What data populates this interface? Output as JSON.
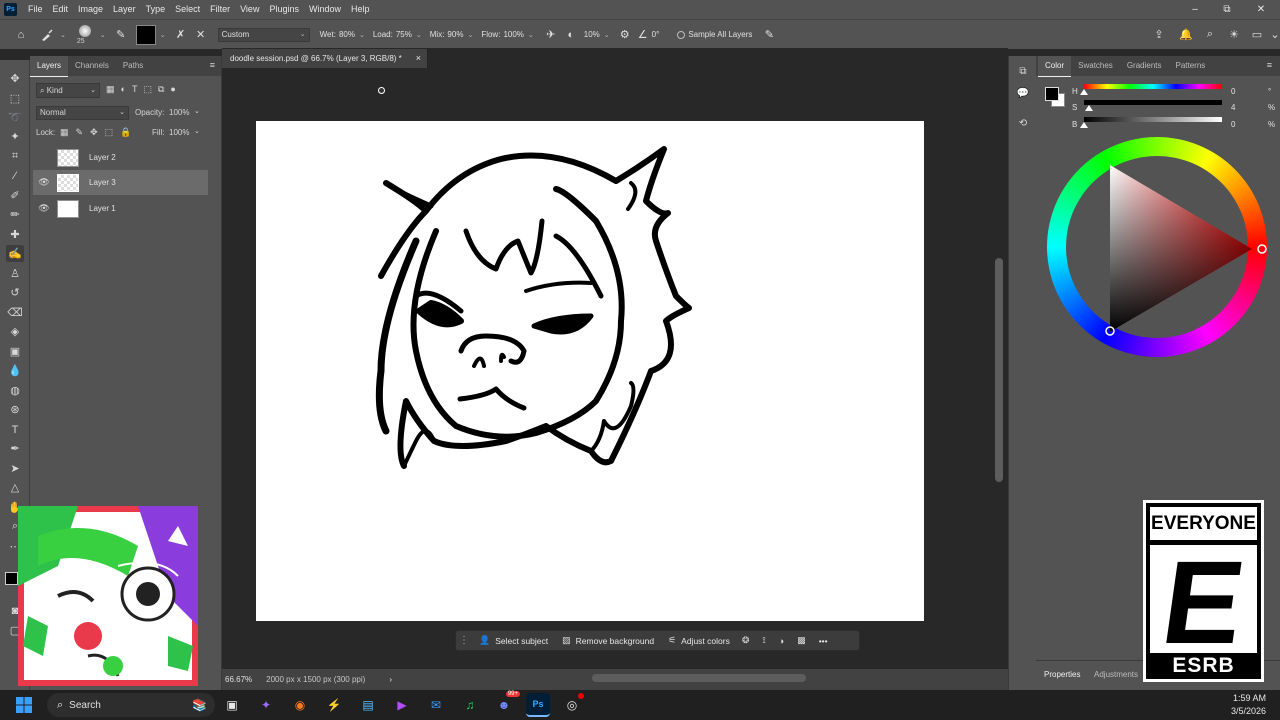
{
  "app": {
    "logo": "Ps"
  },
  "menubar": {
    "items": [
      "File",
      "Edit",
      "Image",
      "Layer",
      "Type",
      "Select",
      "Filter",
      "View",
      "Plugins",
      "Window",
      "Help"
    ]
  },
  "window_controls": {
    "minimize": "–",
    "restore": "⧉",
    "close": "✕"
  },
  "options": {
    "brush_size": "25",
    "preset": "Custom",
    "wet_label": "Wet:",
    "wet_value": "80%",
    "load_label": "Load:",
    "load_value": "75%",
    "mix_label": "Mix:",
    "mix_value": "90%",
    "flow_label": "Flow:",
    "flow_value": "100%",
    "smoothing_value": "10%",
    "angle_value": "0°",
    "sample_all_layers": "Sample All Layers"
  },
  "layers_panel": {
    "tabs": [
      "Layers",
      "Channels",
      "Paths"
    ],
    "filter_label": "Kind",
    "blend_mode": "Normal",
    "opacity_label": "Opacity:",
    "opacity_value": "100%",
    "lock_label": "Lock:",
    "fill_label": "Fill:",
    "fill_value": "100%",
    "layers": [
      {
        "name": "Layer 2",
        "visible": false,
        "selected": false
      },
      {
        "name": "Layer 3",
        "visible": true,
        "selected": true
      },
      {
        "name": "Layer 1",
        "visible": true,
        "selected": false
      }
    ]
  },
  "document": {
    "tab_title": "doodle session.psd @ 66.7% (Layer 3, RGB/8) *",
    "tab_close": "×",
    "zoom": "66.67%",
    "dimensions": "2000 px x 1500 px (300 ppi)",
    "status_caret": "›"
  },
  "context_bar": {
    "select_subject": "Select subject",
    "remove_background": "Remove background",
    "adjust_colors": "Adjust colors",
    "more": "•••"
  },
  "color_panel": {
    "tabs": [
      "Color",
      "Swatches",
      "Gradients",
      "Patterns"
    ],
    "h_label": "H",
    "h_value": "0",
    "h_unit": "°",
    "s_label": "S",
    "s_value": "4",
    "s_unit": "%",
    "b_label": "B",
    "b_value": "0",
    "b_unit": "%"
  },
  "bottom_tabs": {
    "properties": "Properties",
    "adjustments": "Adjustments"
  },
  "esrb": {
    "top": "EVERYONE",
    "letter": "E",
    "bottom": "ESRB"
  },
  "taskbar": {
    "search_label": "Search",
    "time": "1:59 AM",
    "date": "3/5/2026",
    "badge": "99+"
  }
}
